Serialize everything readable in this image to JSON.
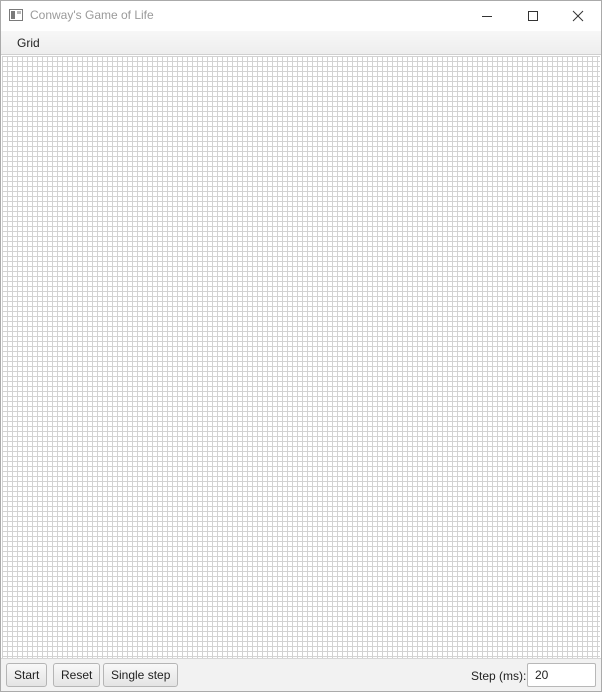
{
  "window": {
    "title": "Conway's Game of Life"
  },
  "menu": {
    "items": [
      {
        "label": "Grid"
      }
    ]
  },
  "toolbar": {
    "start_label": "Start",
    "reset_label": "Reset",
    "single_step_label": "Single step",
    "step_label": "Step (ms):",
    "step_value": "20"
  },
  "icons": {
    "app": "window-app-icon",
    "minimize": "minimize-icon",
    "maximize": "maximize-icon",
    "close": "close-icon"
  },
  "colors": {
    "grid_line": "#d2d2d2",
    "grid_background": "#ffffff",
    "toolbar_background": "#f2f2f2"
  }
}
